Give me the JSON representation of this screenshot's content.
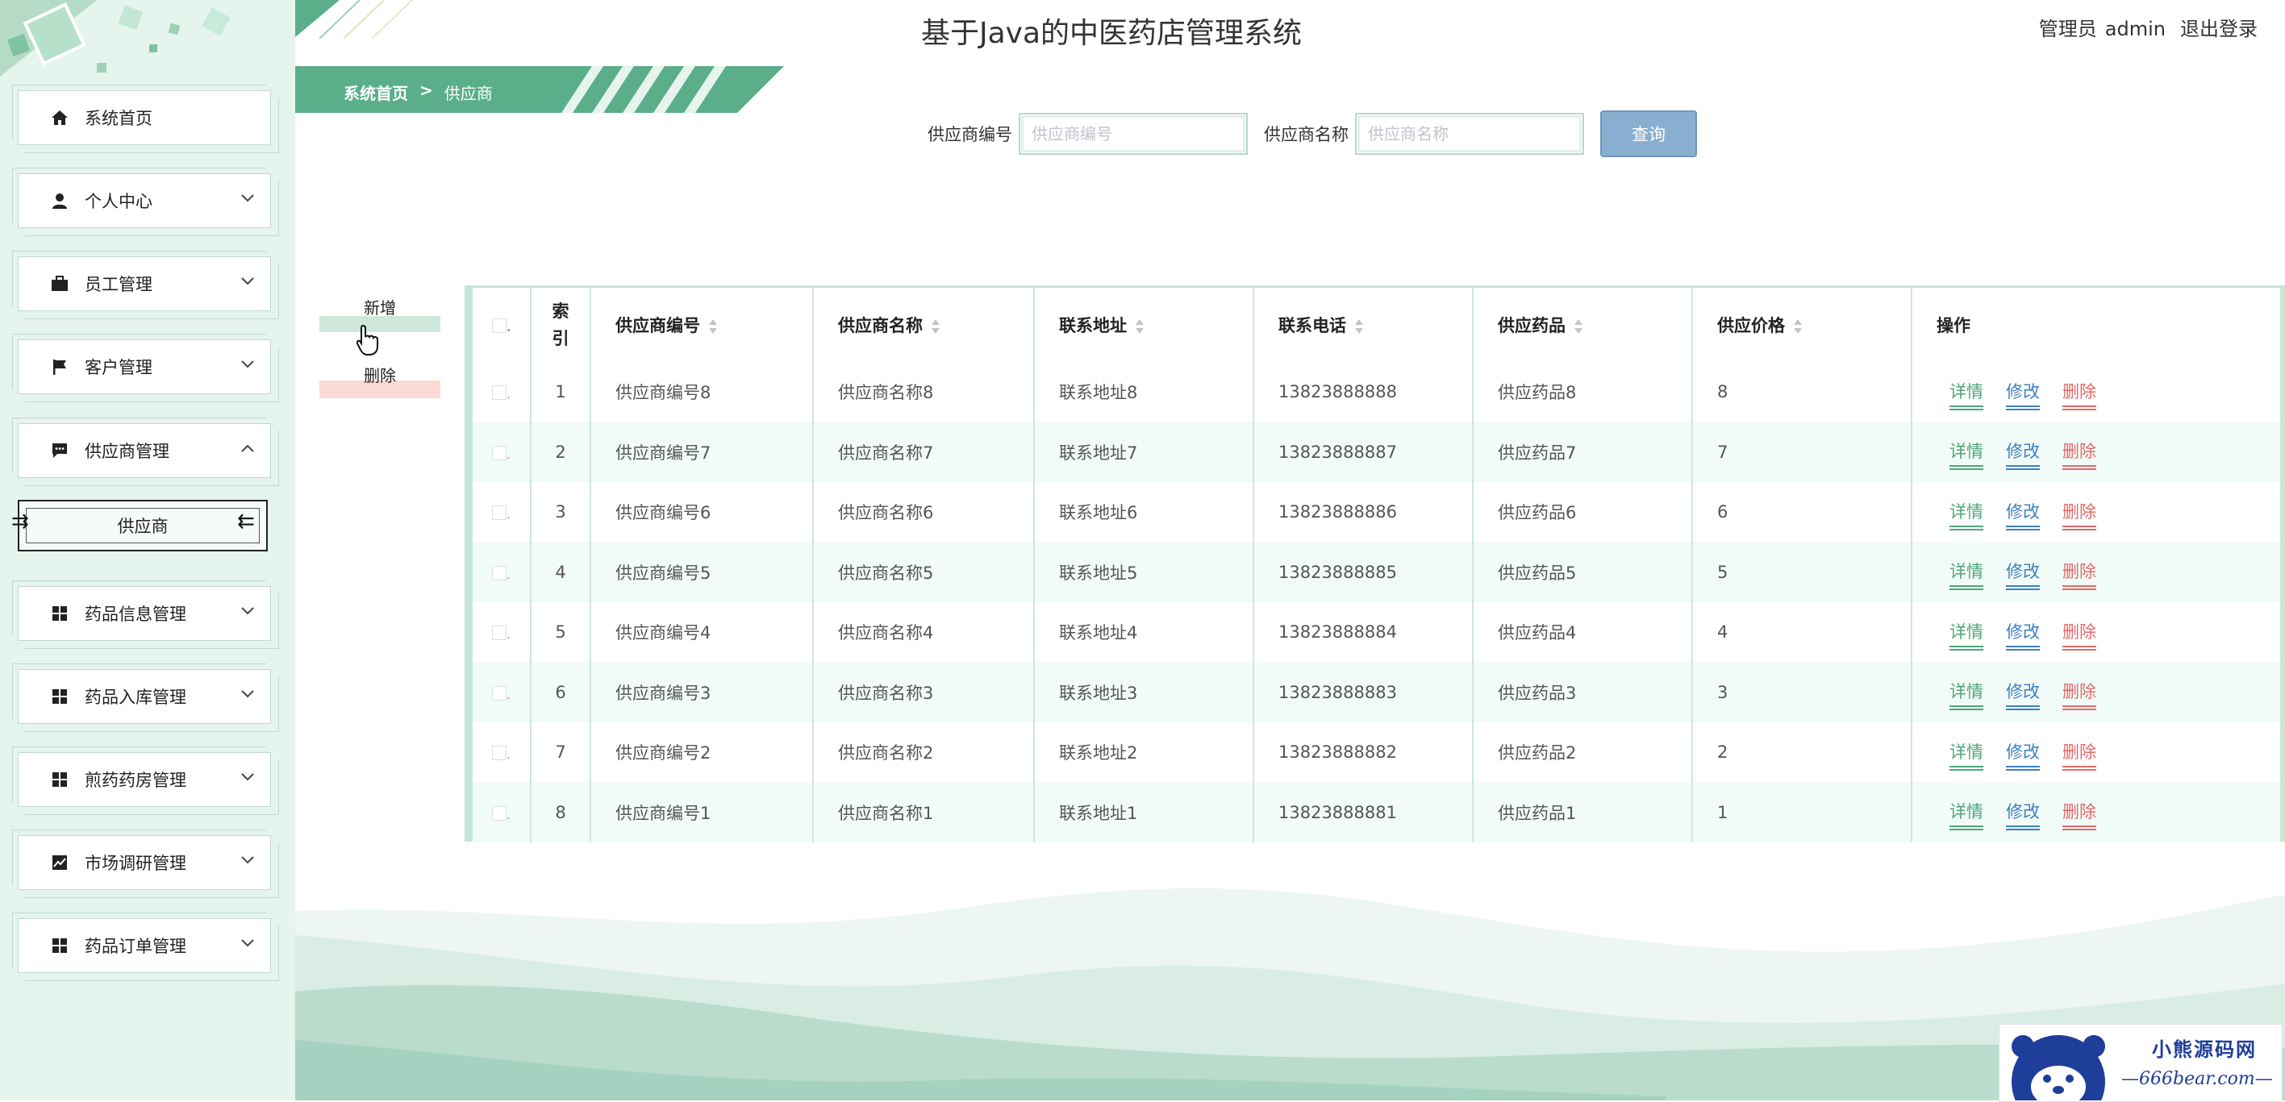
{
  "header": {
    "title": "基于Java的中医药店管理系统",
    "user_role": "管理员",
    "username": "admin",
    "logout_label": "退出登录"
  },
  "breadcrumb": {
    "home": "系统首页",
    "separator": ">",
    "current": "供应商"
  },
  "sidebar": {
    "items": [
      {
        "label": "系统首页",
        "icon": "home-icon"
      },
      {
        "label": "个人中心",
        "icon": "user-icon"
      },
      {
        "label": "员工管理",
        "icon": "briefcase-icon"
      },
      {
        "label": "客户管理",
        "icon": "flag-icon"
      },
      {
        "label": "供应商管理",
        "icon": "message-icon"
      },
      {
        "label": "药品信息管理",
        "icon": "grid-icon"
      },
      {
        "label": "药品入库管理",
        "icon": "grid-icon"
      },
      {
        "label": "煎药药房管理",
        "icon": "grid-icon"
      },
      {
        "label": "市场调研管理",
        "icon": "chart-icon"
      },
      {
        "label": "药品订单管理",
        "icon": "grid-icon"
      }
    ],
    "sub_item": "供应商"
  },
  "search": {
    "field1_label": "供应商编号",
    "field1_placeholder": "供应商编号",
    "field2_label": "供应商名称",
    "field2_placeholder": "供应商名称",
    "button": "查询"
  },
  "actions": {
    "add": "新增",
    "delete": "删除"
  },
  "table": {
    "headers": {
      "index": "索引",
      "code": "供应商编号",
      "name": "供应商名称",
      "address": "联系地址",
      "phone": "联系电话",
      "drug": "供应药品",
      "price": "供应价格",
      "ops": "操作"
    },
    "op_labels": {
      "detail": "详情",
      "edit": "修改",
      "delete": "删除"
    },
    "rows": [
      {
        "index": "1",
        "code": "供应商编号8",
        "name": "供应商名称8",
        "address": "联系地址8",
        "phone": "13823888888",
        "drug": "供应药品8",
        "price": "8"
      },
      {
        "index": "2",
        "code": "供应商编号7",
        "name": "供应商名称7",
        "address": "联系地址7",
        "phone": "13823888887",
        "drug": "供应药品7",
        "price": "7"
      },
      {
        "index": "3",
        "code": "供应商编号6",
        "name": "供应商名称6",
        "address": "联系地址6",
        "phone": "13823888886",
        "drug": "供应药品6",
        "price": "6"
      },
      {
        "index": "4",
        "code": "供应商编号5",
        "name": "供应商名称5",
        "address": "联系地址5",
        "phone": "13823888885",
        "drug": "供应药品5",
        "price": "5"
      },
      {
        "index": "5",
        "code": "供应商编号4",
        "name": "供应商名称4",
        "address": "联系地址4",
        "phone": "13823888884",
        "drug": "供应药品4",
        "price": "4"
      },
      {
        "index": "6",
        "code": "供应商编号3",
        "name": "供应商名称3",
        "address": "联系地址3",
        "phone": "13823888883",
        "drug": "供应药品3",
        "price": "3"
      },
      {
        "index": "7",
        "code": "供应商编号2",
        "name": "供应商名称2",
        "address": "联系地址2",
        "phone": "13823888882",
        "drug": "供应药品2",
        "price": "2"
      },
      {
        "index": "8",
        "code": "供应商编号1",
        "name": "供应商名称1",
        "address": "联系地址1",
        "phone": "13823888881",
        "drug": "供应药品1",
        "price": "1"
      }
    ]
  },
  "watermark": {
    "cn": "小熊源码网",
    "en": "—666bear.com—"
  },
  "colors": {
    "accent_green": "#5aae8a",
    "sidebar_bg": "#e6f4ee",
    "search_button": "#88aed0",
    "detail_link": "#4fa57a",
    "edit_link": "#3e7fc4",
    "delete_link": "#e26a6a"
  }
}
